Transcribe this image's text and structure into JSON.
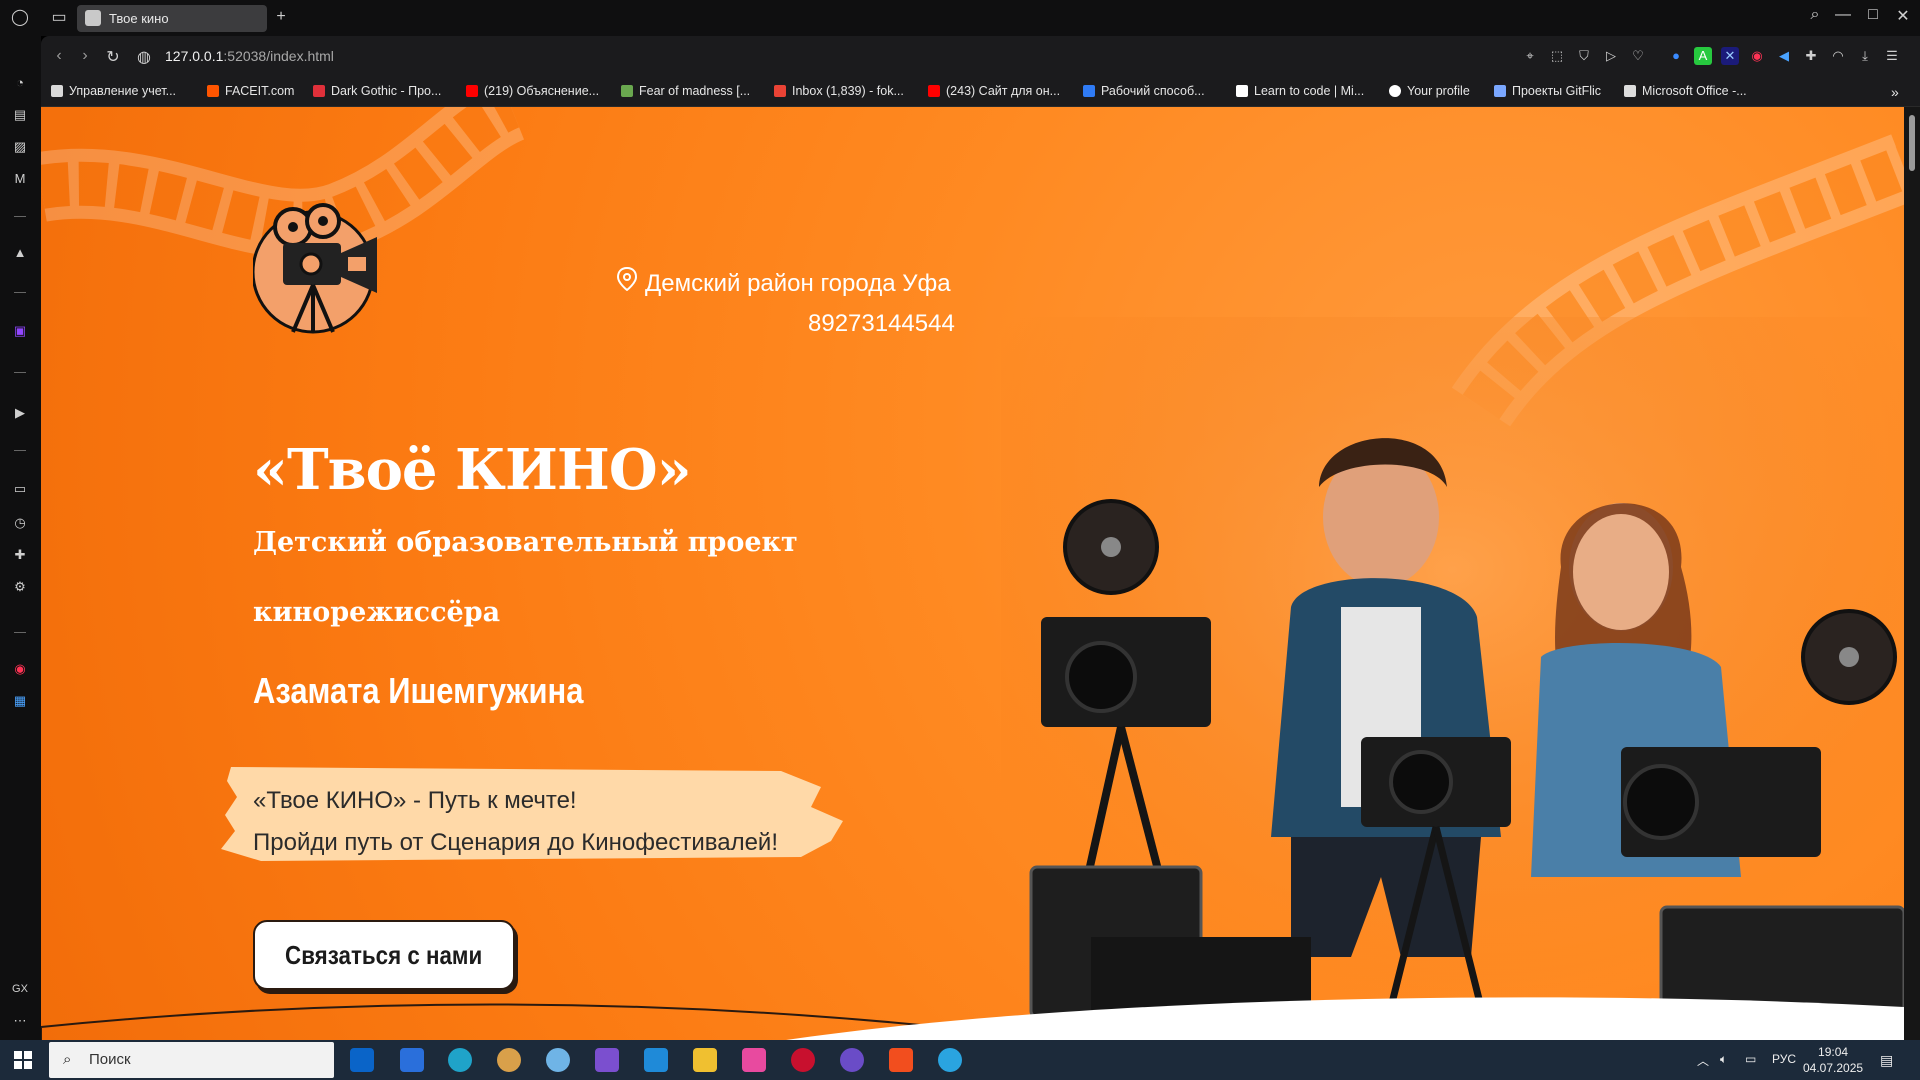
{
  "browser": {
    "tab_title": "Твое кино",
    "url_host": "127.0.0.1",
    "url_rest": ":52038/index.html",
    "bookmarks": [
      {
        "label": "Управление учет...",
        "color": "#d9d9d9"
      },
      {
        "label": "FACEIT.com",
        "color": "#ff5500"
      },
      {
        "label": "Dark Gothic - Про...",
        "color": "#e0303a"
      },
      {
        "label": "(219) Объяснение...",
        "color": "#ff0000"
      },
      {
        "label": "Fear of madness [...",
        "color": "#6aa84f"
      },
      {
        "label": "Inbox (1,839) - fok...",
        "color": "#ea4335"
      },
      {
        "label": "(243) Сайт для он...",
        "color": "#ff0000"
      },
      {
        "label": "Рабочий способ...",
        "color": "#2f7bf5"
      },
      {
        "label": "Learn to code | Mi...",
        "color": "#ffffff"
      },
      {
        "label": "Your profile",
        "color": "#ffffff"
      },
      {
        "label": "Проекты GitFlic",
        "color": "#7aa7ff"
      },
      {
        "label": "Microsoft Office -...",
        "color": "#dddddd"
      }
    ]
  },
  "hero": {
    "location": "Демский район города Уфа",
    "phone": "89273144544",
    "title": "«Твоё КИНО»",
    "subtitle_line1": "Детский образовательный проект",
    "subtitle_line2": "кинорежиссёра",
    "director_name": "Азамата Ишемгужина",
    "slogan_line1": "«Твое КИНО» - Путь к мечте!",
    "slogan_line2": "Пройди путь от Сценария до Кинофестивалей!",
    "cta_label": "Связаться с нами"
  },
  "colors": {
    "accent_orange": "#ff8a22",
    "highlight_cream": "#ffd9a8"
  },
  "taskbar": {
    "search_placeholder": "Поиск",
    "language": "РУС",
    "time": "19:04",
    "date": "04.07.2025"
  }
}
